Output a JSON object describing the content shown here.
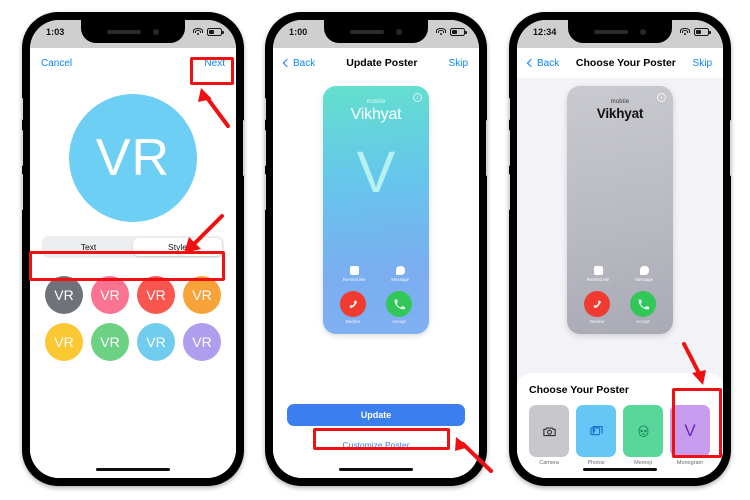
{
  "page": {
    "background": "#ffffff",
    "annotation_color": "#ef1111"
  },
  "phones": [
    {
      "id": "phone-1",
      "status": {
        "time": "1:03",
        "wifi_icon": "wifi-icon",
        "battery_icon": "battery-icon"
      },
      "nav": {
        "left_label": "Cancel",
        "title": "",
        "right_label": "Next"
      },
      "avatar": {
        "initials": "VR",
        "color": "#6ecff5"
      },
      "segmented": {
        "options": [
          "Text",
          "Style"
        ],
        "selected": "Style"
      },
      "swatches": [
        {
          "initials": "VR",
          "color": "#6f7379",
          "name": "gray"
        },
        {
          "initials": "VR",
          "color": "#fa7391",
          "name": "pink"
        },
        {
          "initials": "VR",
          "color": "#f9564f",
          "name": "red"
        },
        {
          "initials": "VR",
          "color": "#f7a33a",
          "name": "orange"
        },
        {
          "initials": "VR",
          "color": "#fbc733",
          "name": "yellow"
        },
        {
          "initials": "VR",
          "color": "#6dd184",
          "name": "green"
        },
        {
          "initials": "VR",
          "color": "#71cdee",
          "name": "light-blue"
        },
        {
          "initials": "VR",
          "color": "#af9ded",
          "name": "purple"
        }
      ]
    },
    {
      "id": "phone-2",
      "status": {
        "time": "1:00",
        "wifi_icon": "wifi-icon",
        "battery_icon": "battery-icon"
      },
      "nav": {
        "left_label": "Back",
        "title": "Update Poster",
        "right_label": "Skip"
      },
      "poster": {
        "line_label": "mobile",
        "name": "Vikhyat",
        "monogram": "V",
        "info_icon": "info-icon",
        "style": "teal-gradient",
        "actions_small": [
          {
            "label": "Remind Me",
            "icon": "alarm-icon"
          },
          {
            "label": "Message",
            "icon": "message-bubble-icon"
          }
        ],
        "actions_large": [
          {
            "label": "Decline",
            "icon": "phone-down-icon",
            "color": "#ef3b30"
          },
          {
            "label": "Accept",
            "icon": "phone-icon",
            "color": "#32c759"
          }
        ]
      },
      "primary_button": "Update",
      "link_button": "Customize Poster"
    },
    {
      "id": "phone-3",
      "status": {
        "time": "12:34",
        "wifi_icon": "wifi-icon",
        "battery_icon": "battery-icon"
      },
      "nav": {
        "left_label": "Back",
        "title": "Choose Your Poster",
        "right_label": "Skip"
      },
      "poster": {
        "line_label": "mobile",
        "name": "Vikhyat",
        "info_icon": "info-icon",
        "style": "gray-gradient",
        "actions_small": [
          {
            "label": "Remind Me",
            "icon": "alarm-icon"
          },
          {
            "label": "Message",
            "icon": "message-bubble-icon"
          }
        ],
        "actions_large": [
          {
            "label": "Decline",
            "icon": "phone-down-icon",
            "color": "#ef3b30"
          },
          {
            "label": "Accept",
            "icon": "phone-icon",
            "color": "#32c759"
          }
        ]
      },
      "sheet_title": "Choose Your Poster",
      "options": [
        {
          "label": "Camera",
          "color": "#c7c7cc",
          "icon": "camera-icon",
          "glyph": "",
          "selected": false
        },
        {
          "label": "Photos",
          "color": "#64c7f5",
          "icon": "photos-icon",
          "glyph": "",
          "selected": false
        },
        {
          "label": "Memoji",
          "color": "#59d69a",
          "icon": "memoji-icon",
          "glyph": "",
          "selected": false
        },
        {
          "label": "Monogram",
          "color": "#c79cec",
          "icon": "monogram-icon",
          "glyph": "V",
          "selected": true
        }
      ]
    }
  ]
}
